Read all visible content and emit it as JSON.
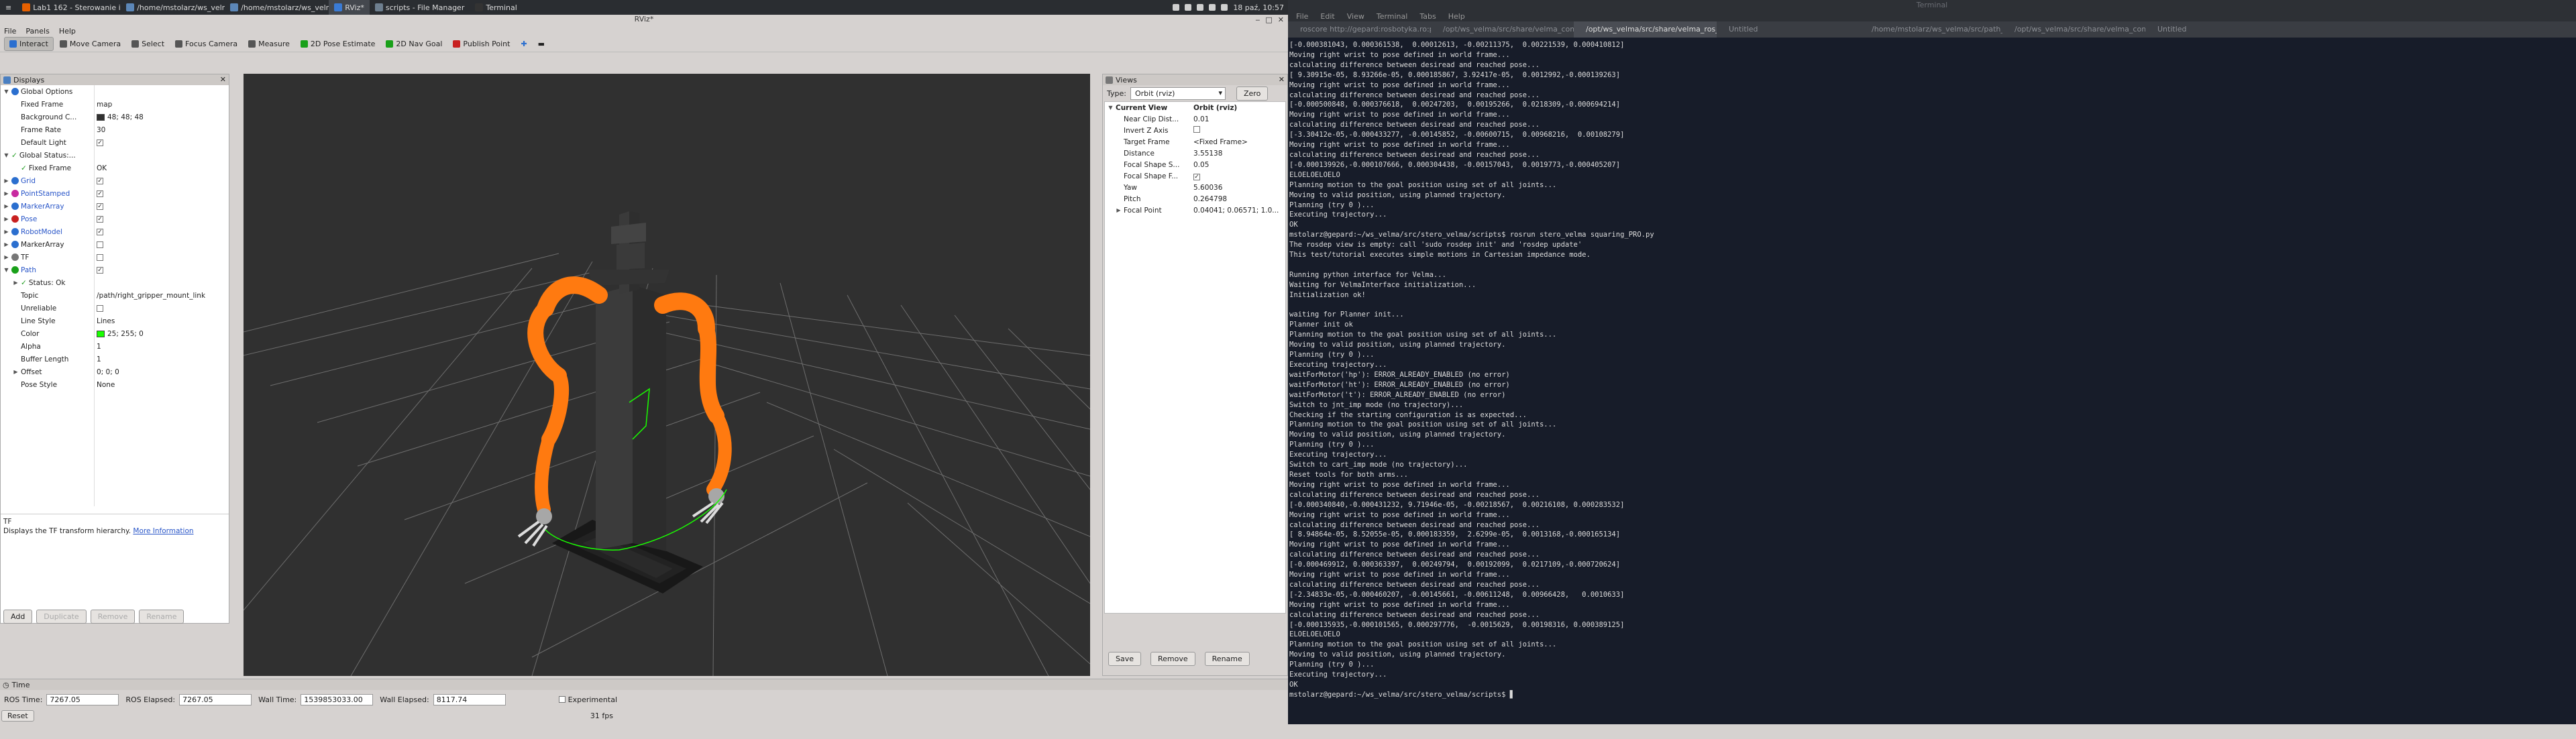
{
  "taskbar": {
    "tasks": [
      {
        "label": "Lab1 162 - Sterowanie i Sym...",
        "active": false,
        "color": "#e66000"
      },
      {
        "label": "/home/mstolarz/ws_velma/s...",
        "active": false,
        "color": "#5c87b8"
      },
      {
        "label": "/home/mstolarz/ws_velma/s...",
        "active": false,
        "color": "#5c87b8"
      },
      {
        "label": "RViz*",
        "active": true,
        "color": "#3a7bd5"
      },
      {
        "label": "scripts - File Manager",
        "active": false,
        "color": "#6e7f8f"
      },
      {
        "label": "Terminal",
        "active": false,
        "color": "#333333"
      }
    ],
    "clock": "18 paź, 10:57"
  },
  "rviz": {
    "title": "RViz*",
    "menu": [
      "File",
      "Panels",
      "Help"
    ],
    "tools": [
      {
        "label": "Interact",
        "icon": "interact-icon",
        "active": true
      },
      {
        "label": "Move Camera",
        "icon": "move-camera-icon",
        "active": false
      },
      {
        "label": "Select",
        "icon": "select-icon",
        "active": false
      },
      {
        "label": "Focus Camera",
        "icon": "focus-camera-icon",
        "active": false
      },
      {
        "label": "Measure",
        "icon": "measure-icon",
        "active": false
      },
      {
        "label": "2D Pose Estimate",
        "icon": "pose-estimate-icon",
        "active": false
      },
      {
        "label": "2D Nav Goal",
        "icon": "nav-goal-icon",
        "active": false
      },
      {
        "label": "Publish Point",
        "icon": "publish-point-icon",
        "active": false
      }
    ],
    "displays": {
      "title": "Displays",
      "rows": [
        {
          "indent": 0,
          "exp": "v",
          "icon": "globe",
          "name": "Global Options",
          "value": "",
          "check": null
        },
        {
          "indent": 1,
          "exp": "",
          "icon": "",
          "name": "Fixed Frame",
          "value": "map",
          "check": null
        },
        {
          "indent": 1,
          "exp": "",
          "icon": "",
          "name": "Background C...",
          "value": "48; 48; 48",
          "swatch": "#303030",
          "check": null
        },
        {
          "indent": 1,
          "exp": "",
          "icon": "",
          "name": "Frame Rate",
          "value": "30",
          "check": null
        },
        {
          "indent": 1,
          "exp": "",
          "icon": "",
          "name": "Default Light",
          "value": "",
          "check": true
        },
        {
          "indent": 0,
          "exp": "v",
          "icon": "ok",
          "name": "Global Status:...",
          "value": "",
          "check": null
        },
        {
          "indent": 1,
          "exp": "",
          "icon": "ok",
          "name": "Fixed Frame",
          "value": "OK",
          "check": null
        },
        {
          "indent": 0,
          "exp": ">",
          "icon": "grid",
          "name": "Grid",
          "value": "",
          "check": true,
          "blue": true
        },
        {
          "indent": 0,
          "exp": ">",
          "icon": "point",
          "name": "PointStamped",
          "value": "",
          "check": true,
          "blue": true
        },
        {
          "indent": 0,
          "exp": ">",
          "icon": "marker",
          "name": "MarkerArray",
          "value": "",
          "check": true,
          "blue": true
        },
        {
          "indent": 0,
          "exp": ">",
          "icon": "pose",
          "name": "Pose",
          "value": "",
          "check": true,
          "blue": true
        },
        {
          "indent": 0,
          "exp": ">",
          "icon": "robot",
          "name": "RobotModel",
          "value": "",
          "check": true,
          "blue": true
        },
        {
          "indent": 0,
          "exp": ">",
          "icon": "marker",
          "name": "MarkerArray",
          "value": "",
          "check": false
        },
        {
          "indent": 0,
          "exp": ">",
          "icon": "tf",
          "name": "TF",
          "value": "",
          "check": false
        },
        {
          "indent": 0,
          "exp": "v",
          "icon": "path",
          "name": "Path",
          "value": "",
          "check": true,
          "blue": true
        },
        {
          "indent": 1,
          "exp": ">",
          "icon": "ok",
          "name": "Status: Ok",
          "value": "",
          "check": null
        },
        {
          "indent": 1,
          "exp": "",
          "icon": "",
          "name": "Topic",
          "value": "/path/right_gripper_mount_link",
          "check": null
        },
        {
          "indent": 1,
          "exp": "",
          "icon": "",
          "name": "Unreliable",
          "value": "",
          "check": false
        },
        {
          "indent": 1,
          "exp": "",
          "icon": "",
          "name": "Line Style",
          "value": "Lines",
          "check": null
        },
        {
          "indent": 1,
          "exp": "",
          "icon": "",
          "name": "Color",
          "value": "25; 255; 0",
          "swatch": "#19ff00",
          "check": null
        },
        {
          "indent": 1,
          "exp": "",
          "icon": "",
          "name": "Alpha",
          "value": "1",
          "check": null
        },
        {
          "indent": 1,
          "exp": "",
          "icon": "",
          "name": "Buffer Length",
          "value": "1",
          "check": null
        },
        {
          "indent": 1,
          "exp": ">",
          "icon": "",
          "name": "Offset",
          "value": "0; 0; 0",
          "check": null
        },
        {
          "indent": 1,
          "exp": "",
          "icon": "",
          "name": "Pose Style",
          "value": "None",
          "check": null
        }
      ],
      "desc_title": "TF",
      "desc_text": "Displays the TF transform hierarchy.",
      "desc_link": "More Information",
      "buttons": [
        {
          "label": "Add",
          "enabled": true
        },
        {
          "label": "Duplicate",
          "enabled": false
        },
        {
          "label": "Remove",
          "enabled": false
        },
        {
          "label": "Rename",
          "enabled": false
        }
      ]
    },
    "views": {
      "title": "Views",
      "type_label": "Type:",
      "type_value": "Orbit (rviz)",
      "zero_label": "Zero",
      "rows": [
        {
          "name": "Current View",
          "value": "Orbit (rviz)",
          "header": true,
          "exp": "v"
        },
        {
          "name": "Near Clip Dist...",
          "value": "0.01"
        },
        {
          "name": "Invert Z Axis",
          "value": "",
          "check": false
        },
        {
          "name": "Target Frame",
          "value": "<Fixed Frame>"
        },
        {
          "name": "Distance",
          "value": "3.55138"
        },
        {
          "name": "Focal Shape S...",
          "value": "0.05"
        },
        {
          "name": "Focal Shape F...",
          "value": "",
          "check": true
        },
        {
          "name": "Yaw",
          "value": "5.60036"
        },
        {
          "name": "Pitch",
          "value": "0.264798"
        },
        {
          "name": "Focal Point",
          "value": "0.04041; 0.06571; 1.0...",
          "exp": ">"
        }
      ],
      "buttons": [
        "Save",
        "Remove",
        "Rename"
      ]
    },
    "time": {
      "title": "Time",
      "ros_time_label": "ROS Time:",
      "ros_time": "7267.05",
      "ros_elapsed_label": "ROS Elapsed:",
      "ros_elapsed": "7267.05",
      "wall_time_label": "Wall Time:",
      "wall_time": "1539853033.00",
      "wall_elapsed_label": "Wall Elapsed:",
      "wall_elapsed": "8117.74",
      "experimental_label": "Experimental",
      "reset_label": "Reset",
      "fps": "31 fps"
    }
  },
  "terminal": {
    "title": "Terminal",
    "menu": [
      "File",
      "Edit",
      "View",
      "Terminal",
      "Tabs",
      "Help"
    ],
    "tabs": [
      {
        "label": "roscore http://gepard:rosbotyka.ro:pw...",
        "active": false
      },
      {
        "label": "/opt/ws_velma/src/share/velma_comm...",
        "active": false
      },
      {
        "label": "/opt/ws_velma/src/share/velma_ros_pl...",
        "active": true
      },
      {
        "label": "Untitled",
        "active": false
      },
      {
        "label": "/home/mstolarz/ws_velma/src/path_tf...",
        "active": false
      },
      {
        "label": "/opt/ws_velma/src/share/velma_comm...",
        "active": false
      },
      {
        "label": "Untitled",
        "active": false
      }
    ],
    "lines": [
      "[-0.000381043, 0.000361538,  0.00012613, -0.00211375,  0.00221539, 0.000410812]",
      "Moving right wrist to pose defined in world frame...",
      "calculating difference between desiread and reached pose...",
      "[ 9.30915e-05, 8.93266e-05, 0.000185867, 3.92417e-05,  0.0012992,-0.000139263]",
      "Moving right wrist to pose defined in world frame...",
      "calculating difference between desiread and reached pose...",
      "[-0.000500848, 0.000376618,  0.00247203,  0.00195266,  0.0218309,-0.000694214]",
      "Moving right wrist to pose defined in world frame...",
      "calculating difference between desiread and reached pose...",
      "[-3.30412e-05,-0.000433277, -0.00145852, -0.00600715,  0.00968216,  0.00108279]",
      "Moving right wrist to pose defined in world frame...",
      "calculating difference between desiread and reached pose...",
      "[-0.000139926,-0.000107666, 0.000304438, -0.00157043,  0.0019773,-0.000405207]",
      "ELOELOELOELO",
      "Planning motion to the goal position using set of all joints...",
      "Moving to valid position, using planned trajectory.",
      "Planning (try 0 )...",
      "Executing trajectory...",
      "OK",
      "mstolarz@gepard:~/ws_velma/src/stero_velma/scripts$ rosrun stero_velma squaring_PRO.py",
      "The rosdep view is empty: call 'sudo rosdep init' and 'rosdep update'",
      "This test/tutorial executes simple motions in Cartesian impedance mode.",
      "",
      "Running python interface for Velma...",
      "Waiting for VelmaInterface initialization...",
      "Initialization ok!",
      "",
      "waiting for Planner init...",
      "Planner init ok",
      "Planning motion to the goal position using set of all joints...",
      "Moving to valid position, using planned trajectory.",
      "Planning (try 0 )...",
      "Executing trajectory...",
      "waitForMotor('hp'): ERROR_ALREADY_ENABLED (no error)",
      "waitForMotor('ht'): ERROR_ALREADY_ENABLED (no error)",
      "waitForMotor('t'): ERROR_ALREADY_ENABLED (no error)",
      "Switch to jnt_imp mode (no trajectory)...",
      "Checking if the starting configuration is as expected...",
      "Planning motion to the goal position using set of all joints...",
      "Moving to valid position, using planned trajectory.",
      "Planning (try 0 )...",
      "Executing trajectory...",
      "Switch to cart_imp mode (no trajectory)...",
      "Reset tools for both arms...",
      "Moving right wrist to pose defined in world frame...",
      "calculating difference between desiread and reached pose...",
      "[-0.000340840,-0.000431232, 9.71946e-05, -0.00218567,  0.00216108, 0.000283532]",
      "Moving right wrist to pose defined in world frame...",
      "calculating difference between desiread and reached pose...",
      "[ 8.94864e-05, 8.52055e-05, 0.000183359,  2.6299e-05,  0.0013168,-0.000165134]",
      "Moving right wrist to pose defined in world frame...",
      "calculating difference between desiread and reached pose...",
      "[-0.000469912, 0.000363397,  0.00249794,  0.00192099,  0.0217109,-0.000720624]",
      "Moving right wrist to pose defined in world frame...",
      "calculating difference between desiread and reached pose...",
      "[-2.34833e-05,-0.000460207, -0.00145661, -0.00611248,  0.00966428,   0.0010633]",
      "Moving right wrist to pose defined in world frame...",
      "calculating difference between desiread and reached pose...",
      "[-0.000135935,-0.000101565, 0.000297776,  -0.0015629,  0.00198316, 0.000389125]",
      "ELOELOELOELO",
      "Planning motion to the goal position using set of all joints...",
      "Moving to valid position, using planned trajectory.",
      "Planning (try 0 )...",
      "Executing trajectory...",
      "OK",
      "mstolarz@gepard:~/ws_velma/src/stero_velma/scripts$ ▋"
    ]
  }
}
